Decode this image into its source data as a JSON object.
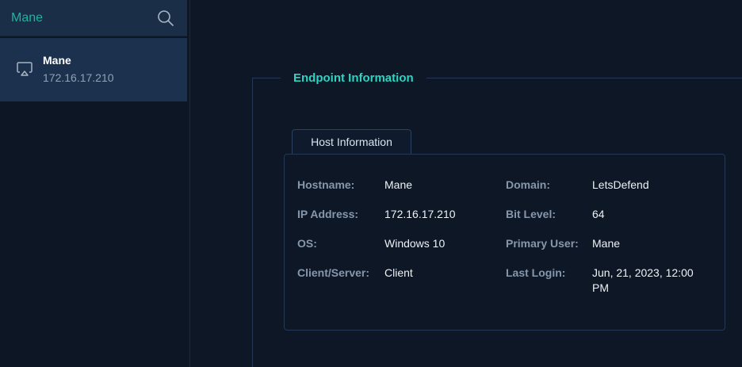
{
  "sidebar": {
    "search": {
      "value": "Mane",
      "icon": "search-icon"
    },
    "endpoint": {
      "name": "Mane",
      "ip": "172.16.17.210",
      "icon": "monitor-icon"
    }
  },
  "main": {
    "section_title": "Endpoint Information",
    "tab_label": "Host Information",
    "fields": {
      "hostname": {
        "label": "Hostname:",
        "value": "Mane"
      },
      "ip_address": {
        "label": "IP Address:",
        "value": "172.16.17.210"
      },
      "os": {
        "label": "OS:",
        "value": "Windows 10"
      },
      "client_server": {
        "label": "Client/Server:",
        "value": "Client"
      },
      "domain": {
        "label": "Domain:",
        "value": "LetsDefend"
      },
      "bit_level": {
        "label": "Bit Level:",
        "value": "64"
      },
      "primary_user": {
        "label": "Primary User:",
        "value": "Mane"
      },
      "last_login": {
        "label": "Last Login:",
        "value": "Jun, 21, 2023, 12:00 PM"
      }
    }
  },
  "colors": {
    "background": "#0d1726",
    "sidebar_selected": "#1c314e",
    "accent_teal": "#2fd3c1",
    "search_text": "#20b2a0",
    "label_gray": "#8797ab",
    "border": "#243754"
  }
}
